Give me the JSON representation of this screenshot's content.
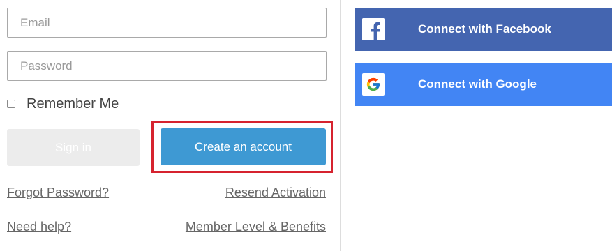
{
  "login": {
    "email_placeholder": "Email",
    "password_placeholder": "Password",
    "remember_label": "Remember Me",
    "signin_label": "Sign in",
    "create_label": "Create an account",
    "forgot_label": "Forgot Password?",
    "resend_label": "Resend Activation",
    "help_label": "Need help?",
    "member_label": "Member Level & Benefits"
  },
  "social": {
    "facebook_label": "Connect with Facebook",
    "google_label": "Connect with Google",
    "facebook_icon": "facebook-icon",
    "google_icon": "google-icon"
  },
  "colors": {
    "create_button": "#3e99d3",
    "facebook": "#4465b0",
    "google": "#4285f4",
    "highlight": "#d6232f"
  }
}
